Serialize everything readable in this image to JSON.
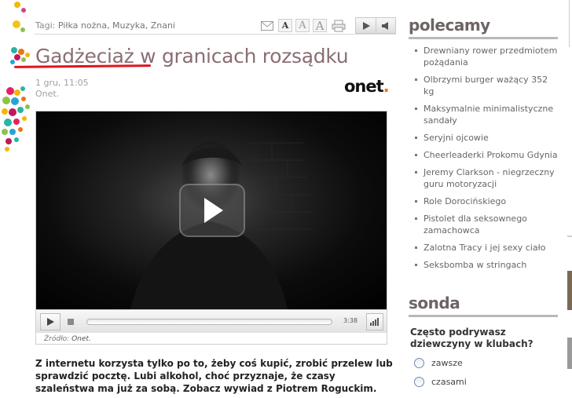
{
  "tagbar": {
    "label": "Tagi:",
    "tags": "Piłka nożna, Muzyka, Znani",
    "font_a_small": "A",
    "font_a_medium": "A",
    "font_a_large": "A"
  },
  "article": {
    "title": "Gadżeciaż w granicach rozsądku",
    "date": "1 gru, 11:05",
    "source_line": "Onet.",
    "logo_text": "onet",
    "logo_dot": ".",
    "lead": "Z internetu korzysta tylko po to, żeby coś kupić, zrobić przelew lub sprawdzić pocztę. Lubi alkohol, choć przyznaje, że czasy szaleństwa ma już za sobą. Zobacz wywiad z Piotrem Roguckim."
  },
  "player": {
    "time": "3:38",
    "source_label": "Źródło:",
    "source_name": "Onet."
  },
  "sidebar": {
    "polecamy_title": "polecamy",
    "items": [
      "Drewniany rower przedmiotem pożądania",
      "Olbrzymi burger ważący 352 kg",
      "Maksymalnie minimalistyczne sandały",
      "Seryjni ojcowie",
      "Cheerleaderki Prokomu Gdynia",
      "Jeremy Clarkson - niegrzeczny guru motoryzacji",
      "Role Dorocińskiego",
      "Pistolet dla seksownego zamachowca",
      "Zalotna Tracy i jej sexy ciało",
      "Seksbomba w stringach"
    ],
    "sonda_title": "sonda",
    "sonda_question": "Często podrywasz dziewczyny w klubach?",
    "sonda_options": [
      "zawsze",
      "czasami"
    ]
  },
  "colors": {
    "title": "#8a6e73",
    "underline": "#e0141e",
    "logo_dot": "#e8751a"
  },
  "icons": {
    "mail": "mail-icon",
    "print": "print-icon",
    "next": "play-next-icon",
    "audio": "speaker-icon"
  }
}
